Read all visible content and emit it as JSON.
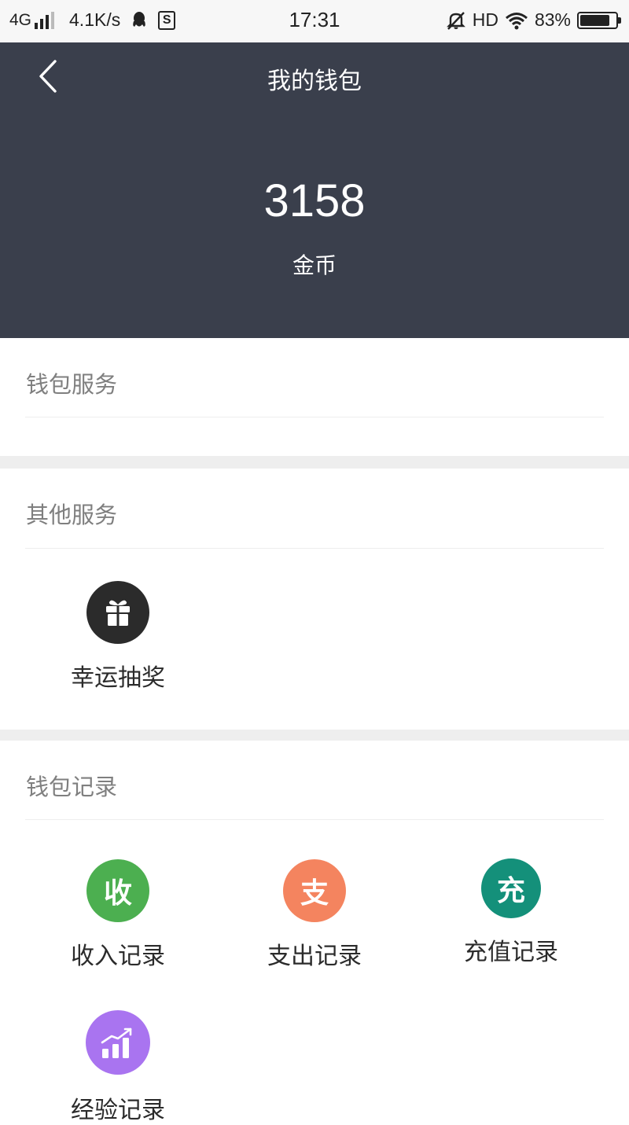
{
  "status_bar": {
    "network": "4G",
    "speed": "4.1K/s",
    "time": "17:31",
    "hd": "HD",
    "battery": "83%",
    "battery_level": 0.83
  },
  "header": {
    "title": "我的钱包",
    "balance": "3158",
    "unit": "金币",
    "bg_color": "#3a3f4c"
  },
  "sections": {
    "wallet_service": {
      "title": "钱包服务"
    },
    "other_service": {
      "title": "其他服务",
      "items": [
        {
          "label": "幸运抽奖",
          "icon": "gift-icon",
          "color": "#2b2b2b"
        }
      ]
    },
    "wallet_records": {
      "title": "钱包记录",
      "items": [
        {
          "label": "收入记录",
          "glyph": "收",
          "color": "#4caf50"
        },
        {
          "label": "支出记录",
          "glyph": "支",
          "color": "#f4845f"
        },
        {
          "label": "充值记录",
          "glyph": "充",
          "color": "#14907a"
        },
        {
          "label": "经验记录",
          "icon": "growth-chart-icon",
          "color": "#a974f0"
        }
      ]
    }
  }
}
